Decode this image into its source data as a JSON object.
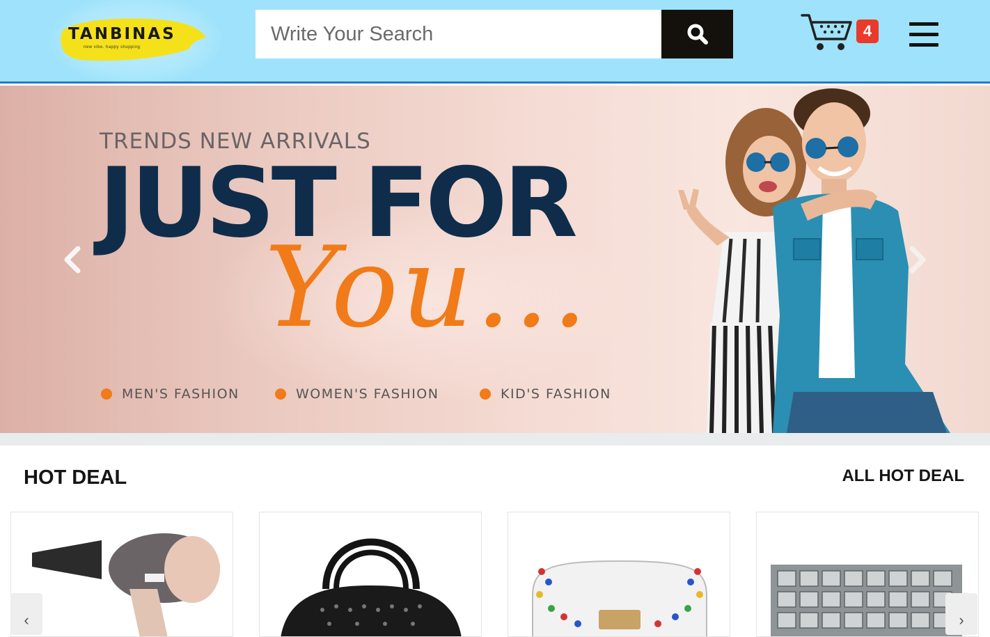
{
  "header": {
    "logo_text": "TANBINAS",
    "logo_tagline": "new vibe. happy shopping",
    "search": {
      "placeholder": "Write Your Search",
      "value": ""
    },
    "cart_count": "4",
    "accent_color": "#9ee3fb"
  },
  "banner": {
    "kicker": "TRENDS NEW ARRIVALS",
    "headline": "JUST FOR",
    "script": "You...",
    "categories": [
      "MEN'S FASHION",
      "WOMEN'S FASHION",
      "KID'S FASHION"
    ],
    "accent_color": "#f07b18",
    "headline_color": "#0f2d4b"
  },
  "hot_deal": {
    "title": "HOT DEAL",
    "all_link": "ALL HOT DEAL",
    "products": [
      {
        "name": "hair-dryer"
      },
      {
        "name": "black-handbag"
      },
      {
        "name": "white-studded-bag"
      },
      {
        "name": "silver-clutch"
      }
    ],
    "prev_glyph": "‹",
    "next_glyph": "›"
  }
}
